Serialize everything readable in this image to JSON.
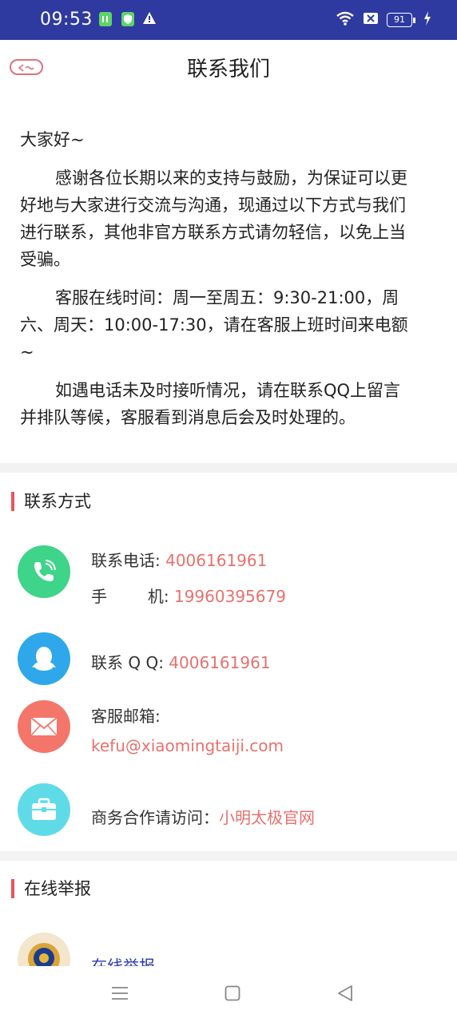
{
  "status": {
    "time": "09:53",
    "battery": "91"
  },
  "header": {
    "title": "联系我们"
  },
  "notice": {
    "greeting": "大家好~",
    "p1": "感谢各位长期以来的支持与鼓励，为保证可以更好地与大家进行交流与沟通，现通过以下方式与我们进行联系，其他非官方联系方式请勿轻信，以免上当受骗。",
    "p2": "客服在线时间：周一至周五：9:30-21:00，周六、周天：10:00-17:30，请在客服上班时间来电额~",
    "p3": "如遇电话未及时接听情况，请在联系QQ上留言并排队等候，客服看到消息后会及时处理的。"
  },
  "contact": {
    "section_title": "联系方式",
    "phone_label": "联系电话: ",
    "phone_value": "4006161961",
    "mobile_label": "手        机: ",
    "mobile_value": "19960395679",
    "qq_label": "联系 Q Q: ",
    "qq_value": "4006161961",
    "email_label": "客服邮箱:",
    "email_value": "kefu@xiaomingtaiji.com",
    "business_label": "商务合作请访问：",
    "business_link": "小明太极官网",
    "colors": {
      "phone": "#3ed489",
      "qq": "#2ea8ea",
      "email": "#f4766b",
      "business": "#5fdbe8"
    }
  },
  "report": {
    "section_title": "在线举报",
    "link": "在线举报"
  }
}
